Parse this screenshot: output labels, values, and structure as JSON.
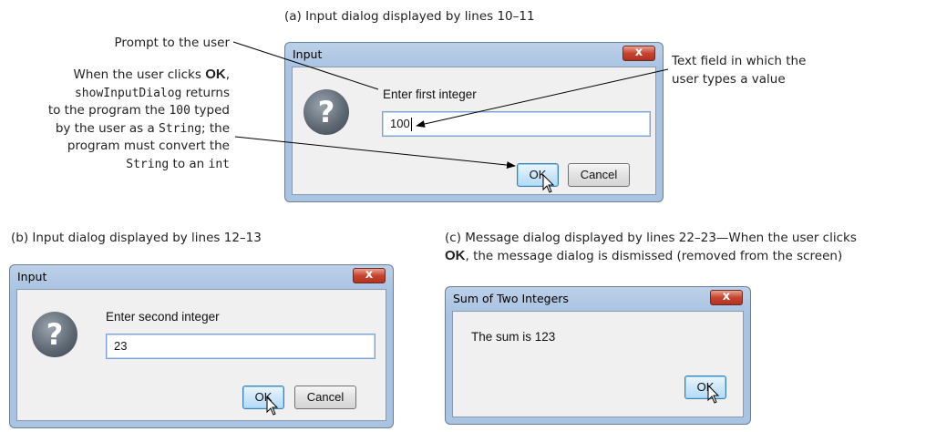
{
  "captions": {
    "a": "(a) Input dialog displayed by lines 10–11",
    "b": "(b) Input dialog displayed by lines 12–13",
    "c_line1": "(c) Message dialog displayed by lines 22–23—When the user clicks",
    "c_line2_bold": "OK",
    "c_line2_rest": ", the message dialog is dismissed (removed from the screen)"
  },
  "annotations": {
    "prompt_to_user": "Prompt to the user",
    "ok_line1_pre": "When the user clicks ",
    "ok_line1_bold": "OK",
    "ok_line1_post": ",",
    "ok_line2_mono": "showInputDialog",
    "ok_line2_post": " returns",
    "ok_line3_pre": "to the program the ",
    "ok_line3_mono": "100",
    "ok_line3_post": " typed",
    "ok_line4_pre": "by the user as a ",
    "ok_line4_mono": "String",
    "ok_line4_post": "; the",
    "ok_line5": "program must convert the",
    "ok_line6_mono1": "String",
    "ok_line6_mid": " to an ",
    "ok_line6_mono2": "int",
    "text_field_1": "Text field in which the",
    "text_field_2": "user types a value"
  },
  "dialog_a": {
    "title": "Input",
    "close_label": "x",
    "prompt": "Enter first integer",
    "value": "100",
    "ok_label": "OK",
    "cancel_label": "Cancel",
    "icon": "question-icon"
  },
  "dialog_b": {
    "title": "Input",
    "close_label": "x",
    "prompt": "Enter second integer",
    "value": "23",
    "ok_label": "OK",
    "cancel_label": "Cancel",
    "icon": "question-icon"
  },
  "dialog_c": {
    "title": "Sum of Two Integers",
    "close_label": "x",
    "message": "The sum is 123",
    "ok_label": "OK"
  },
  "colors": {
    "frame": "#a9c3e2",
    "close_button": "#c7442f",
    "client": "#f0f0f0"
  }
}
